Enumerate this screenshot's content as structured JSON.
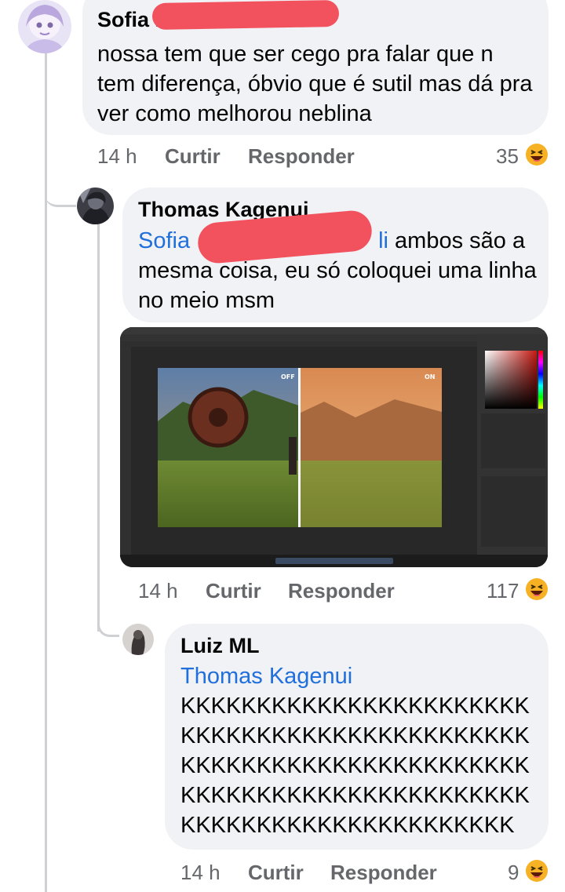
{
  "comments": [
    {
      "author": "Sofia M",
      "text": "nossa tem que ser cego pra falar que n tem diferença, óbvio que é sutil mas dá pra ver como melhorou neblina",
      "time": "14 h",
      "like_label": "Curtir",
      "reply_label": "Responder",
      "reaction_count": "35",
      "reaction_icon": "haha-emoji-icon"
    },
    {
      "author": "Thomas Kagenui",
      "mention_start": "Sofia",
      "mention_end": "li",
      "text": " ambos são a mesma coisa, eu só coloquei uma linha no meio msm",
      "image_labels": {
        "off": "OFF",
        "on": "ON"
      },
      "time": "14 h",
      "like_label": "Curtir",
      "reply_label": "Responder",
      "reaction_count": "117",
      "reaction_icon": "haha-emoji-icon"
    },
    {
      "author": "Luiz ML",
      "mention": "Thomas Kagenui",
      "lines": [
        "KKKKKKKKKKKKKKKKKKKKKKK",
        "KKKKKKKKKKKKKKKKKKKKKKK",
        "KKKKKKKKKKKKKKKKKKKKKKK",
        "KKKKKKKKKKKKKKKKKKKKKKK",
        "KKKKKKKKKKKKKKKKKKKKKK"
      ],
      "time": "14 h",
      "like_label": "Curtir",
      "reply_label": "Responder",
      "reaction_count": "9",
      "reaction_icon": "haha-emoji-icon"
    }
  ],
  "colors": {
    "bubble": "#f0f2f5",
    "mention": "#216fdb",
    "meta": "#65676b",
    "redaction": "#f2525e",
    "haha": "#f7b125"
  }
}
